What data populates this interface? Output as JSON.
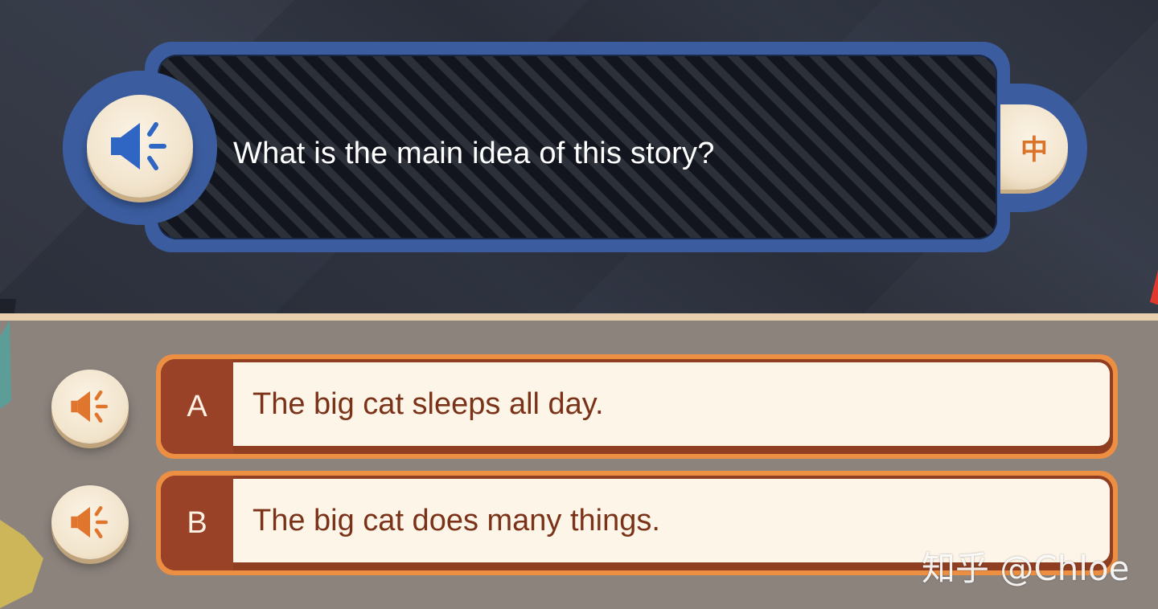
{
  "question": {
    "text": "What is the main idea of this story?",
    "speaker_icon": "speaker-icon",
    "translate_label": "中"
  },
  "options": [
    {
      "letter": "A",
      "text": "The big cat sleeps all day.",
      "speaker_icon": "speaker-icon"
    },
    {
      "letter": "B",
      "text": "The big cat does many things.",
      "speaker_icon": "speaker-icon"
    }
  ],
  "watermark": "知乎 @Chloe",
  "colors": {
    "panel_blue": "#3b5da0",
    "speaker_blue": "#2f66c4",
    "speaker_orange": "#e0762e",
    "option_border": "#ec8f42",
    "option_letter_bg": "#9a4227",
    "option_text": "#7a3318",
    "option_bg": "#fdf5e8"
  }
}
